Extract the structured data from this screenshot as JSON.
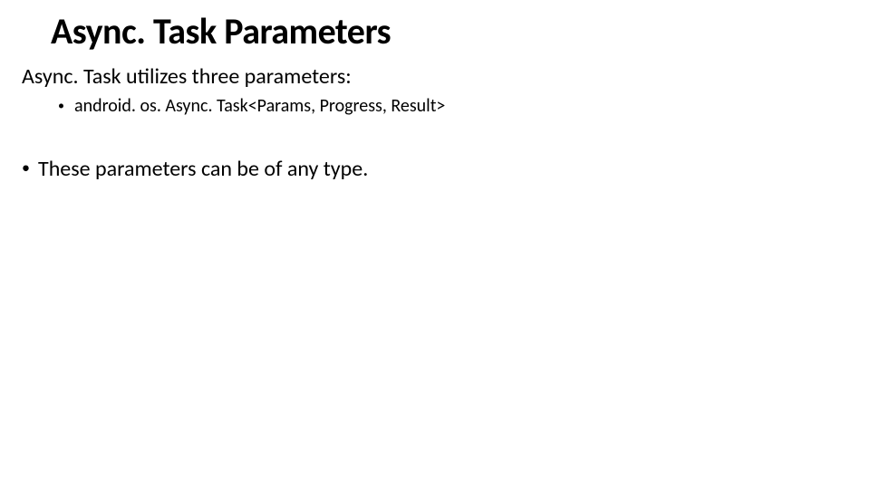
{
  "slide": {
    "title": "Async. Task Parameters",
    "intro": "Async. Task utilizes three parameters:",
    "codeLine": "android. os. Async. Task<Params, Progress, Result>",
    "note": "These parameters can be of any type."
  }
}
